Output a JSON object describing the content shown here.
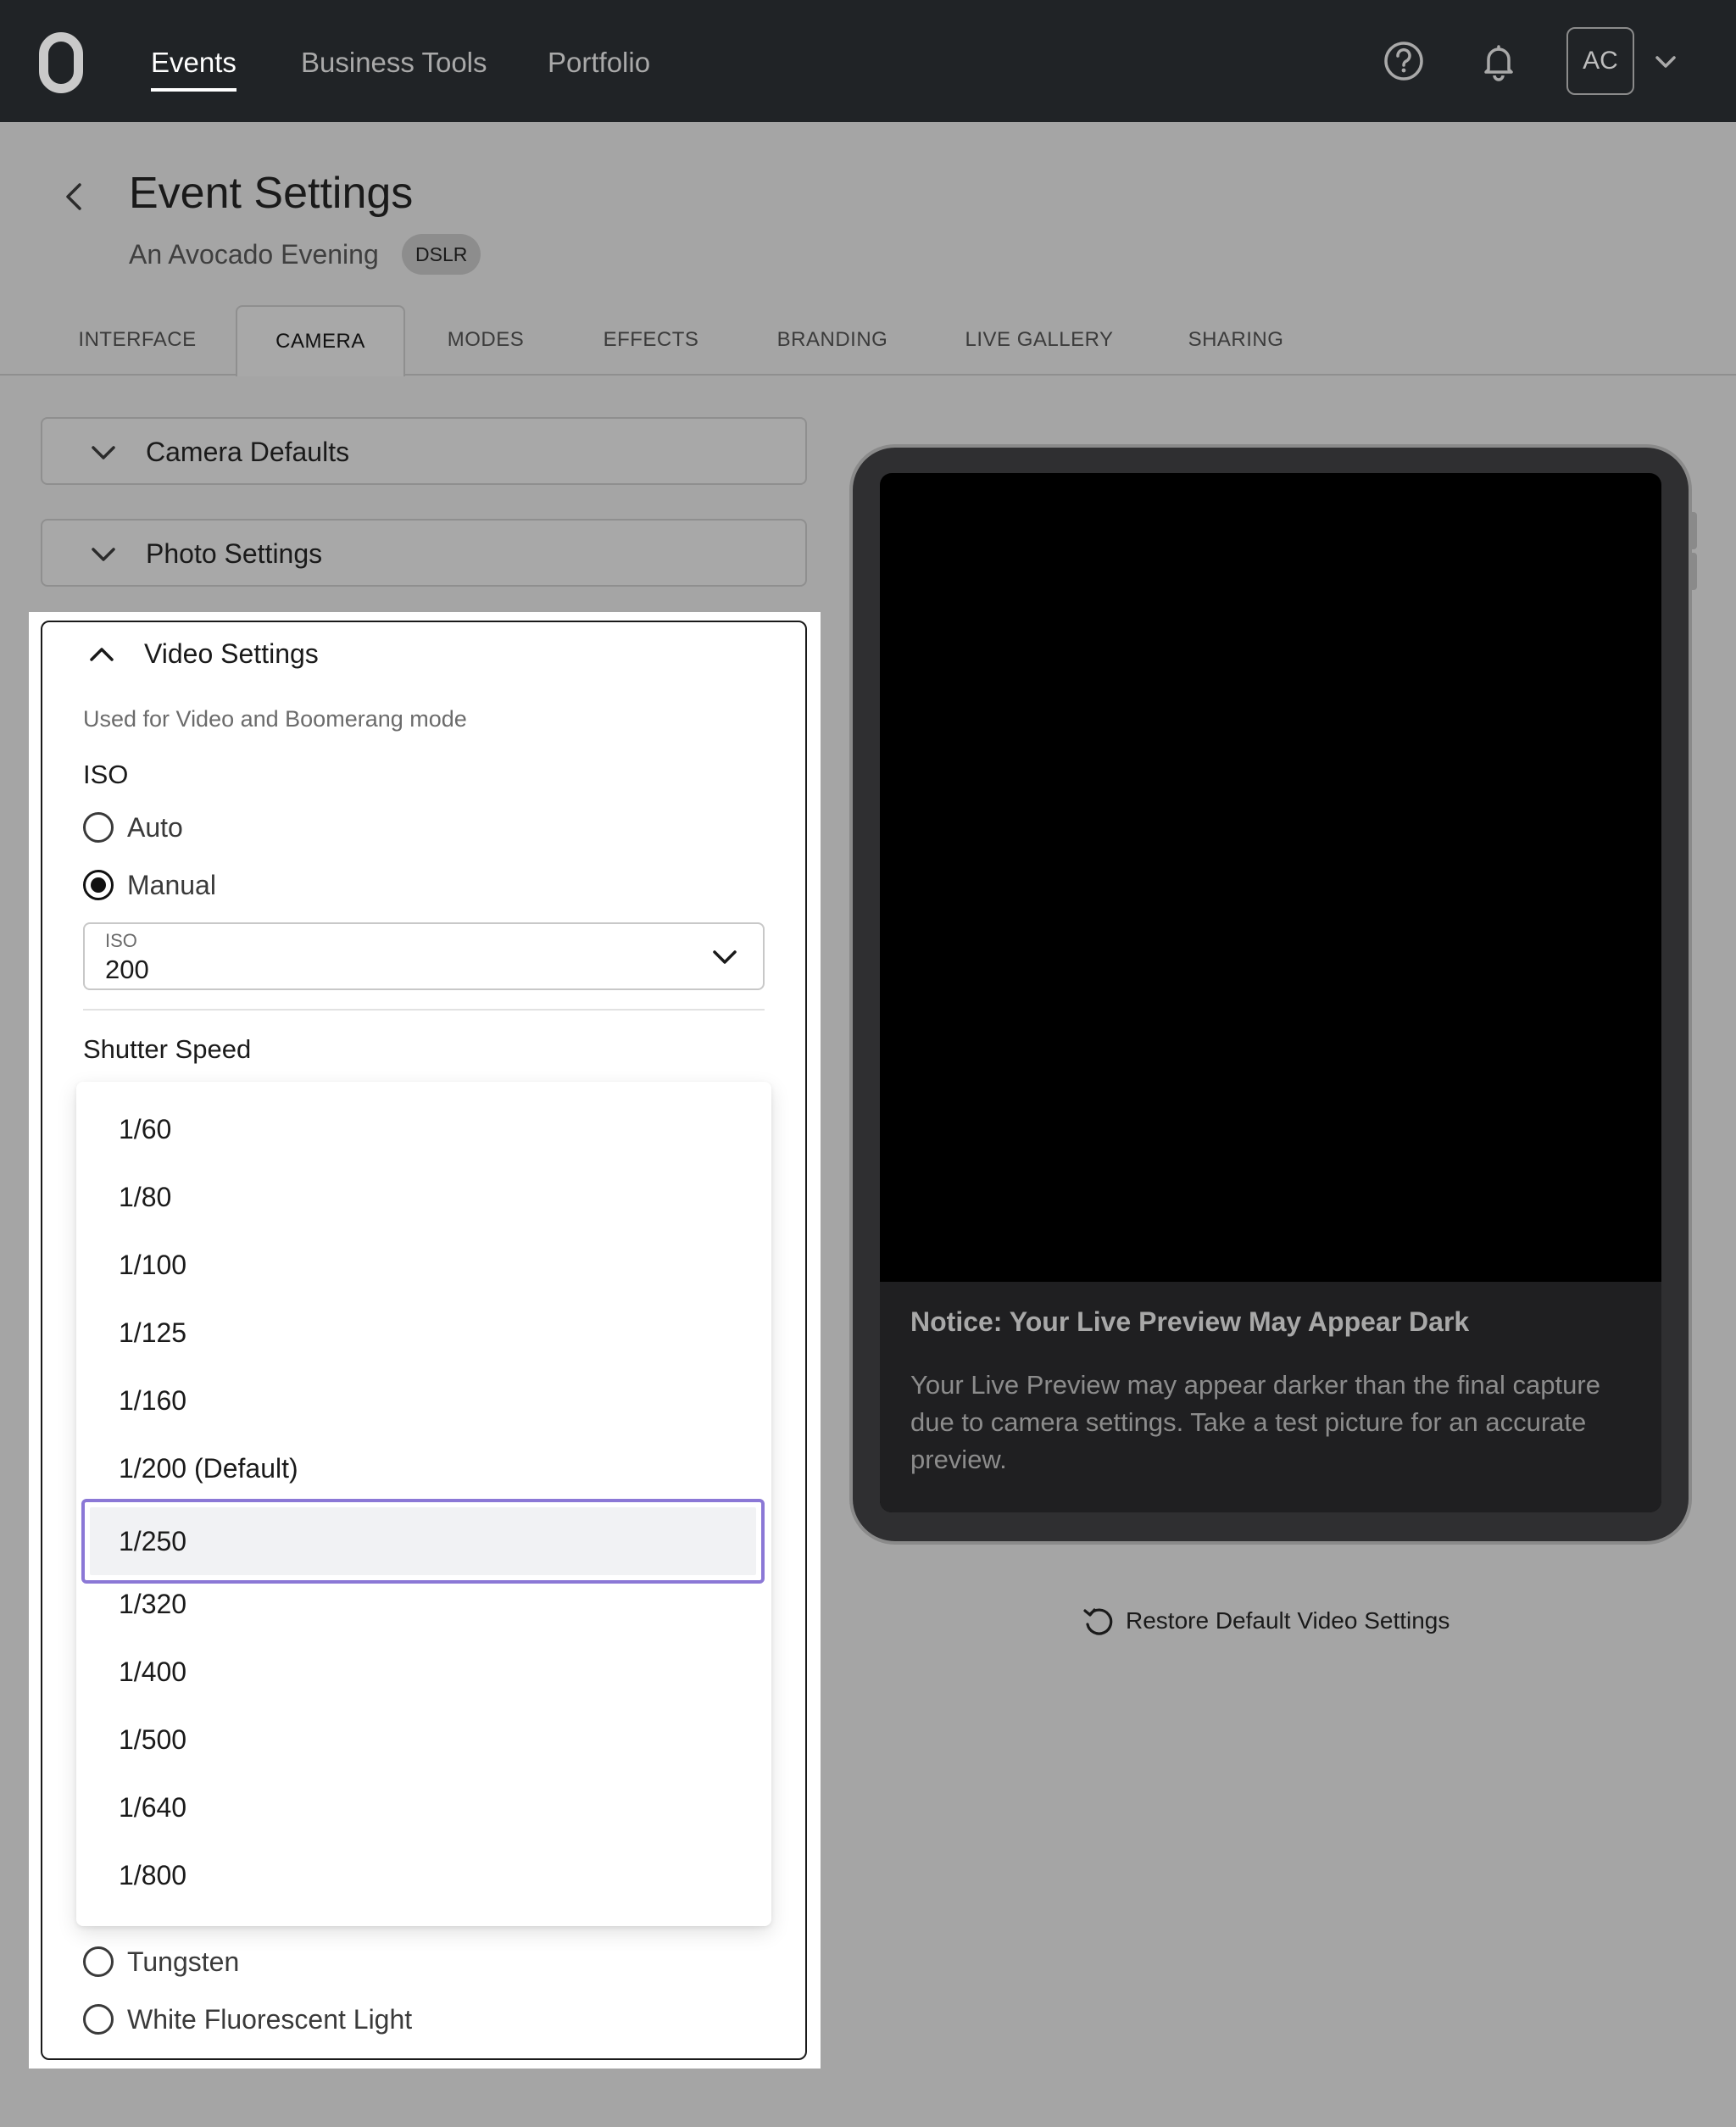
{
  "nav": {
    "links": [
      "Events",
      "Business Tools",
      "Portfolio"
    ],
    "avatar_initials": "AC"
  },
  "header": {
    "title": "Event Settings",
    "event_name": "An Avocado Evening",
    "badge": "DSLR"
  },
  "tabs": [
    "INTERFACE",
    "CAMERA",
    "MODES",
    "EFFECTS",
    "BRANDING",
    "LIVE GALLERY",
    "SHARING"
  ],
  "active_tab": "CAMERA",
  "accordions": {
    "camera_defaults": "Camera Defaults",
    "photo_settings": "Photo Settings"
  },
  "video_settings": {
    "title": "Video Settings",
    "description": "Used for Video and Boomerang mode",
    "iso": {
      "label": "ISO",
      "options": [
        "Auto",
        "Manual"
      ],
      "selected": "Manual",
      "select_label": "ISO",
      "select_value": "200"
    },
    "shutter_speed": {
      "label": "Shutter Speed",
      "options": [
        "1/60",
        "1/80",
        "1/100",
        "1/125",
        "1/160",
        "1/200 (Default)",
        "1/250",
        "1/320",
        "1/400",
        "1/500",
        "1/640",
        "1/800"
      ],
      "highlighted": "1/250"
    },
    "white_balance_visible_options": [
      "Tungsten",
      "White Fluorescent Light"
    ]
  },
  "preview": {
    "notice_title": "Notice: Your Live Preview May Appear Dark",
    "notice_body": "Your Live Preview may appear darker than the final capture due to camera settings. Take a test picture for an accurate preview."
  },
  "restore_label": "Restore Default Video Settings",
  "colors": {
    "topbar": "#202326",
    "overlay_bg": "#a5a5a5",
    "highlight_border": "#8b78d6"
  },
  "icons": {
    "help": "help-circle-icon",
    "bell": "bell-icon",
    "chevron": "chevron-down-icon",
    "back": "chevron-left-icon",
    "restore": "restore-icon"
  }
}
